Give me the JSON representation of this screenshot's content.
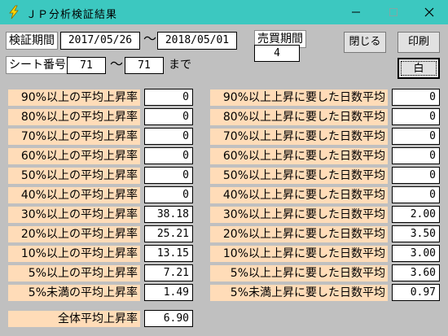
{
  "window": {
    "title": "ＪＰ分析検証結果"
  },
  "header": {
    "period_label": "検証期間",
    "start_date": "2017/05/26",
    "tilde": "〜",
    "end_date": "2018/05/01",
    "sales_period_label": "売買期間",
    "sales_period_value": "4",
    "sheet_label": "シート番号",
    "sheet_from": "71",
    "sheet_to": "71",
    "made": "まで"
  },
  "buttons": {
    "close": "閉じる",
    "print": "印刷",
    "white": "白"
  },
  "left_rows": [
    {
      "label": "90%以上の平均上昇率",
      "value": "0"
    },
    {
      "label": "80%以上の平均上昇率",
      "value": "0"
    },
    {
      "label": "70%以上の平均上昇率",
      "value": "0"
    },
    {
      "label": "60%以上の平均上昇率",
      "value": "0"
    },
    {
      "label": "50%以上の平均上昇率",
      "value": "0"
    },
    {
      "label": "40%以上の平均上昇率",
      "value": "0"
    },
    {
      "label": "30%以上の平均上昇率",
      "value": "38.18"
    },
    {
      "label": "20%以上の平均上昇率",
      "value": "25.21"
    },
    {
      "label": "10%以上の平均上昇率",
      "value": "13.15"
    },
    {
      "label": "5%以上の平均上昇率",
      "value": "7.21"
    },
    {
      "label": "5%未満の平均上昇率",
      "value": "1.49"
    }
  ],
  "right_rows": [
    {
      "label": "90%以上上昇に要した日数平均",
      "value": "0"
    },
    {
      "label": "80%以上上昇に要した日数平均",
      "value": "0"
    },
    {
      "label": "70%以上上昇に要した日数平均",
      "value": "0"
    },
    {
      "label": "60%以上上昇に要した日数平均",
      "value": "0"
    },
    {
      "label": "50%以上上昇に要した日数平均",
      "value": "0"
    },
    {
      "label": "40%以上上昇に要した日数平均",
      "value": "0"
    },
    {
      "label": "30%以上上昇に要した日数平均",
      "value": "2.00"
    },
    {
      "label": "20%以上上昇に要した日数平均",
      "value": "3.50"
    },
    {
      "label": "10%以上上昇に要した日数平均",
      "value": "3.00"
    },
    {
      "label": "5%以上上昇に要した日数平均",
      "value": "3.60"
    },
    {
      "label": "5%未満上昇に要した日数平均",
      "value": "0.97"
    }
  ],
  "total": {
    "label": "全体平均上昇率",
    "value": "6.90"
  },
  "colors": {
    "titlebar": "#3cc8c0",
    "label_bg": "#ffdcb8",
    "window_bg": "#c0c0c0"
  }
}
